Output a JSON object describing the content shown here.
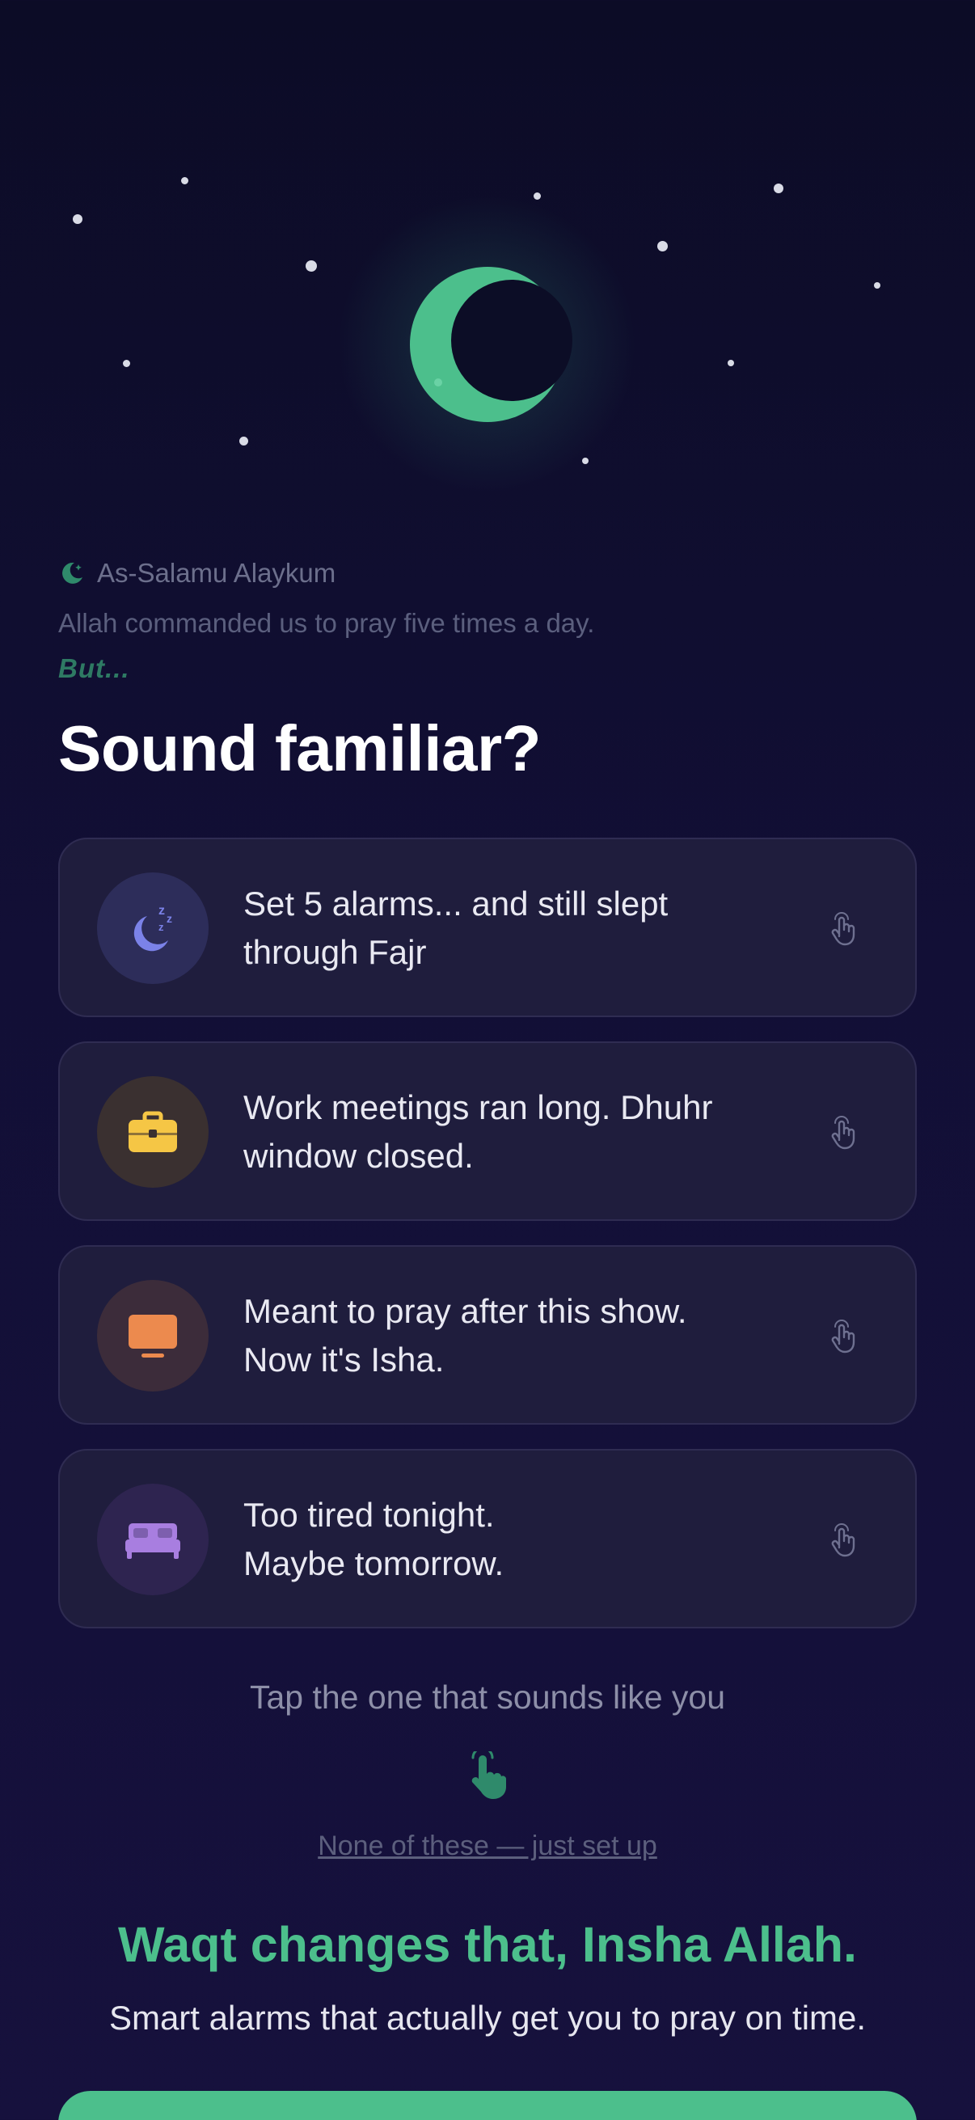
{
  "hero": {
    "moon_color": "#4cbf8c"
  },
  "greeting": {
    "icon": "crescent-moon-star-icon",
    "text": "As-Salamu Alaykum"
  },
  "intro": "Allah commanded us to pray five times a day.",
  "but": "But...",
  "title": "Sound familiar?",
  "cards": [
    {
      "icon": "sleep-moon-icon",
      "text_line1": "Set 5 alarms... and still slept",
      "text_line2": "through Fajr",
      "icon_bg": "#2d2d5a",
      "icon_color": "#7b82e8"
    },
    {
      "icon": "briefcase-icon",
      "text_line1": "Work meetings ran long. Dhuhr",
      "text_line2": "window closed.",
      "icon_bg": "#3a3030",
      "icon_color": "#f5c645"
    },
    {
      "icon": "tv-icon",
      "text_line1": "Meant to pray after this show.",
      "text_line2": "Now it's Isha.",
      "icon_bg": "#3c2c3a",
      "icon_color": "#ec8a4e"
    },
    {
      "icon": "bed-icon",
      "text_line1": "Too tired tonight.",
      "text_line2": "Maybe tomorrow.",
      "icon_bg": "#2e2450",
      "icon_color": "#a87ee0"
    }
  ],
  "tap_hint": "Tap the one that sounds like you",
  "skip_link": "None of these — just set up",
  "tagline": "Waqt changes that, Insha Allah.",
  "subline": "Smart alarms that actually get you to pray on time.",
  "colors": {
    "accent": "#4cbf8c",
    "background": "#120f36",
    "card": "#1f1d3d"
  }
}
